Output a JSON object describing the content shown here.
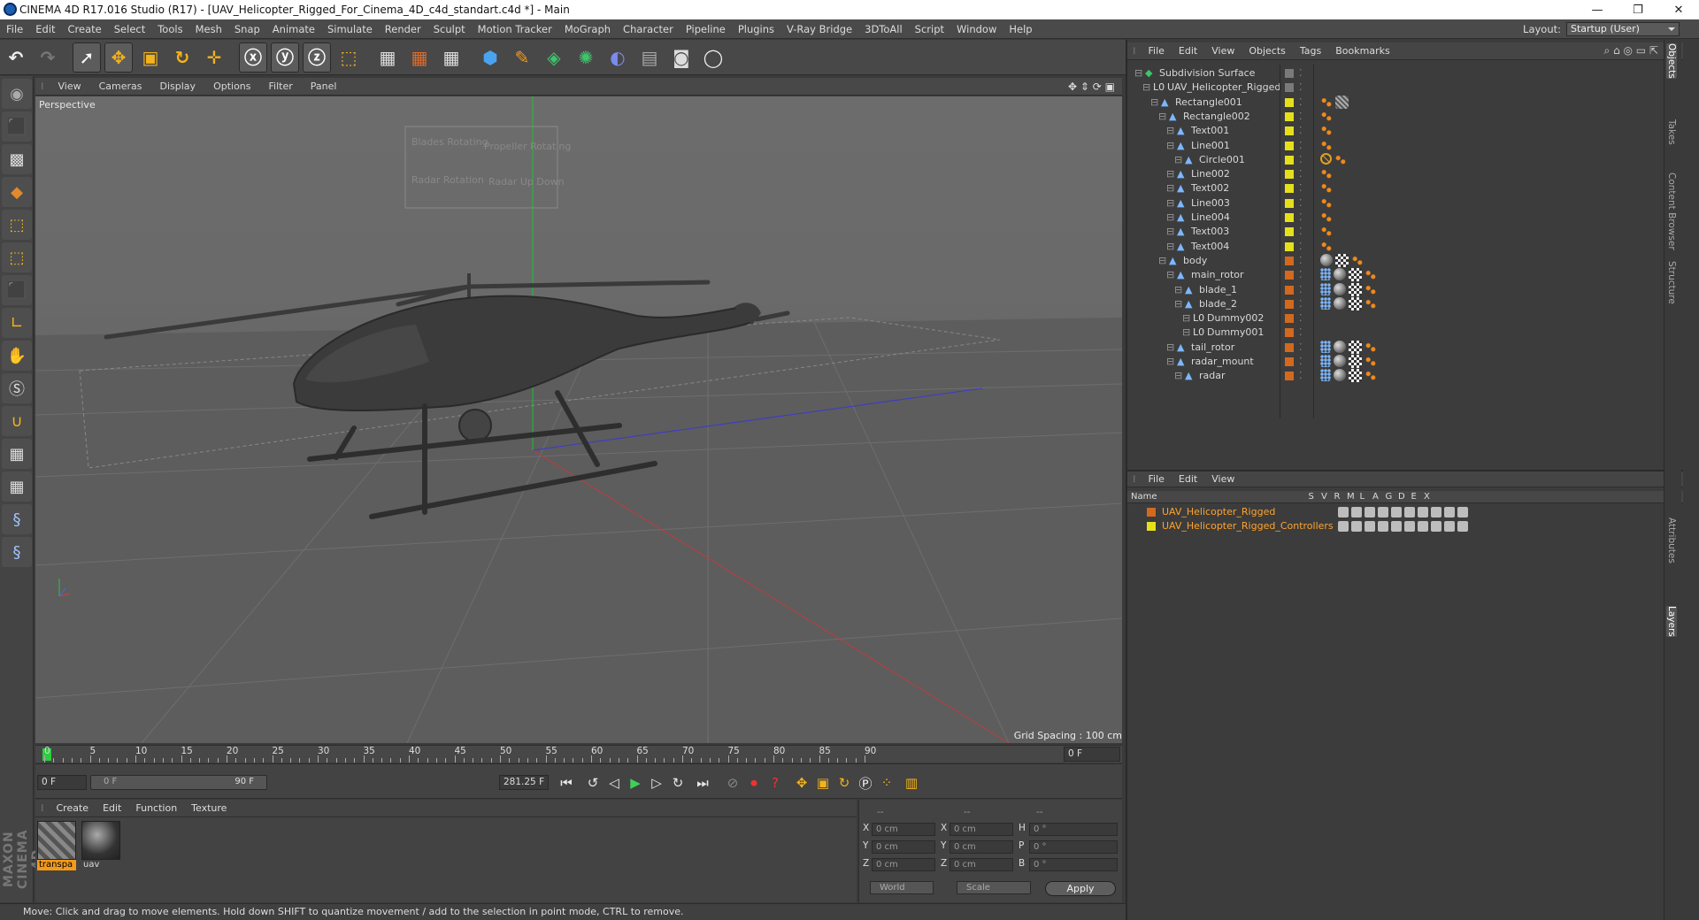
{
  "window": {
    "title": "CINEMA 4D R17.016 Studio (R17) - [UAV_Helicopter_Rigged_For_Cinema_4D_c4d_standart.c4d *] - Main",
    "controls": [
      "—",
      "❐",
      "✕"
    ]
  },
  "menubar": [
    "File",
    "Edit",
    "Create",
    "Select",
    "Tools",
    "Mesh",
    "Snap",
    "Animate",
    "Simulate",
    "Render",
    "Sculpt",
    "Motion Tracker",
    "MoGraph",
    "Character",
    "Pipeline",
    "Plugins",
    "V-Ray Bridge",
    "3DToAll",
    "Script",
    "Window",
    "Help"
  ],
  "layout": {
    "label": "Layout:",
    "value": "Startup (User)"
  },
  "viewport": {
    "menu": [
      "View",
      "Cameras",
      "Display",
      "Options",
      "Filter",
      "Panel"
    ],
    "label": "Perspective",
    "grid_spacing": "Grid Spacing : 100 cm",
    "hud": [
      "Blades Rotating",
      "Propeller Rotating",
      "Radar Rotation",
      "Radar Up Down"
    ]
  },
  "timeline": {
    "ticks": [
      "0",
      "5",
      "10",
      "15",
      "20",
      "25",
      "30",
      "35",
      "40",
      "45",
      "50",
      "55",
      "60",
      "65",
      "70",
      "75",
      "80",
      "85",
      "90"
    ],
    "frame_end": "0 F"
  },
  "playback": {
    "current": "0 F",
    "range_start": "0 F",
    "range_end": "90 F",
    "fps_field": "281.25 F"
  },
  "materials": {
    "menu": [
      "Create",
      "Edit",
      "Function",
      "Texture"
    ],
    "items": [
      {
        "name": "transpa"
      },
      {
        "name": "uav"
      }
    ]
  },
  "coords": {
    "headers": [
      "--",
      "--",
      "--"
    ],
    "rows": [
      {
        "a": "X",
        "av": "0 cm",
        "b": "X",
        "bv": "0 cm",
        "c": "H",
        "cv": "0 °"
      },
      {
        "a": "Y",
        "av": "0 cm",
        "b": "Y",
        "bv": "0 cm",
        "c": "P",
        "cv": "0 °"
      },
      {
        "a": "Z",
        "av": "0 cm",
        "b": "Z",
        "bv": "0 cm",
        "c": "B",
        "cv": "0 °"
      }
    ],
    "mode1": "World",
    "mode2": "Scale",
    "apply": "Apply"
  },
  "status": "Move: Click and drag to move elements. Hold down SHIFT to quantize movement / add to the selection in point mode, CTRL to remove.",
  "brand": "MAXON CINEMA 4D",
  "objects": {
    "menu": [
      "File",
      "Edit",
      "View",
      "Objects",
      "Tags",
      "Bookmarks"
    ],
    "tree": [
      {
        "name": "Subdivision Surface",
        "indent": 0,
        "color": "#7a7a7a",
        "icon": "◆",
        "tags": []
      },
      {
        "name": "UAV_Helicopter_Rigged",
        "indent": 1,
        "color": "#7a7a7a",
        "icon": "L0",
        "tags": []
      },
      {
        "name": "Rectangle001",
        "indent": 2,
        "color": "#e6e01a",
        "icon": "▲",
        "tags": [
          "orange",
          "hatch"
        ]
      },
      {
        "name": "Rectangle002",
        "indent": 3,
        "color": "#e6e01a",
        "icon": "▲",
        "tags": [
          "orange"
        ]
      },
      {
        "name": "Text001",
        "indent": 4,
        "color": "#e6e01a",
        "icon": "▲",
        "tags": [
          "orange"
        ]
      },
      {
        "name": "Line001",
        "indent": 4,
        "color": "#e6e01a",
        "icon": "▲",
        "tags": [
          "orange"
        ]
      },
      {
        "name": "Circle001",
        "indent": 5,
        "color": "#e6e01a",
        "icon": "▲",
        "tags": [
          "forbid",
          "orange"
        ]
      },
      {
        "name": "Line002",
        "indent": 4,
        "color": "#e6e01a",
        "icon": "▲",
        "tags": [
          "orange"
        ]
      },
      {
        "name": "Text002",
        "indent": 4,
        "color": "#e6e01a",
        "icon": "▲",
        "tags": [
          "orange"
        ]
      },
      {
        "name": "Line003",
        "indent": 4,
        "color": "#e6e01a",
        "icon": "▲",
        "tags": [
          "orange"
        ]
      },
      {
        "name": "Line004",
        "indent": 4,
        "color": "#e6e01a",
        "icon": "▲",
        "tags": [
          "orange"
        ]
      },
      {
        "name": "Text003",
        "indent": 4,
        "color": "#e6e01a",
        "icon": "▲",
        "tags": [
          "orange"
        ]
      },
      {
        "name": "Text004",
        "indent": 4,
        "color": "#e6e01a",
        "icon": "▲",
        "tags": [
          "orange"
        ]
      },
      {
        "name": "body",
        "indent": 3,
        "color": "#d2691e",
        "icon": "▲",
        "tags": [
          "sphere",
          "check",
          "orange"
        ]
      },
      {
        "name": "main_rotor",
        "indent": 4,
        "color": "#d2691e",
        "icon": "▲",
        "tags": [
          "dots",
          "sphere",
          "check",
          "orange"
        ]
      },
      {
        "name": "blade_1",
        "indent": 5,
        "color": "#d2691e",
        "icon": "▲",
        "tags": [
          "dots",
          "sphere",
          "check",
          "orange"
        ]
      },
      {
        "name": "blade_2",
        "indent": 5,
        "color": "#d2691e",
        "icon": "▲",
        "tags": [
          "dots",
          "sphere",
          "check",
          "orange"
        ]
      },
      {
        "name": "Dummy002",
        "indent": 6,
        "color": "#d2691e",
        "icon": "L0",
        "tags": []
      },
      {
        "name": "Dummy001",
        "indent": 6,
        "color": "#d2691e",
        "icon": "L0",
        "tags": []
      },
      {
        "name": "tail_rotor",
        "indent": 4,
        "color": "#d2691e",
        "icon": "▲",
        "tags": [
          "dots",
          "sphere",
          "check",
          "orange"
        ]
      },
      {
        "name": "radar_mount",
        "indent": 4,
        "color": "#d2691e",
        "icon": "▲",
        "tags": [
          "dots",
          "sphere",
          "check",
          "orange"
        ]
      },
      {
        "name": "radar",
        "indent": 5,
        "color": "#d2691e",
        "icon": "▲",
        "tags": [
          "dots",
          "sphere",
          "check",
          "orange"
        ]
      }
    ]
  },
  "layers": {
    "menu": [
      "File",
      "Edit",
      "View"
    ],
    "headers": [
      "Name",
      "S",
      "V",
      "R",
      "M",
      "L",
      "A",
      "G",
      "D",
      "E",
      "X"
    ],
    "items": [
      {
        "name": "UAV_Helicopter_Rigged",
        "color": "#d2691e"
      },
      {
        "name": "UAV_Helicopter_Rigged_Controllers",
        "color": "#e6e01a"
      }
    ]
  },
  "side_tabs": [
    "Objects",
    "Takes",
    "Content Browser",
    "Structure",
    "Attributes",
    "Layers"
  ]
}
